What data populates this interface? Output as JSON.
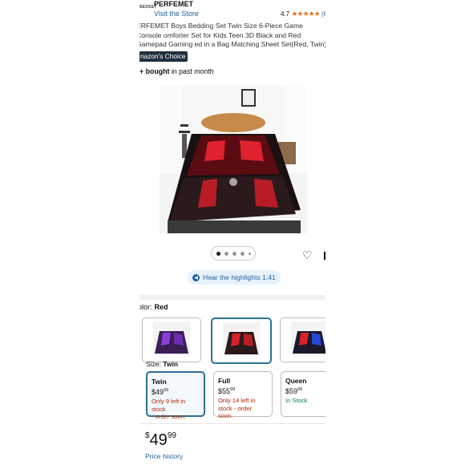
{
  "brand": {
    "logo_text": "BEDSET",
    "name": "PERFEMET",
    "visit_label": "Visit the Store",
    "rating": "4.7",
    "rating_count": "(6"
  },
  "product": {
    "title": "ERFEMET Boys Bedding Set Twin Size 6-Piece Game Console omforter Set for Kids Teen 3D Black and Red Gamepad Gaming ed in a Bag Matching Sheet Set(Red, Twin)",
    "badge": "nazon's Choice",
    "bought_count": "+ bought",
    "bought_suffix": " in past month"
  },
  "actions": {
    "highlights_label": "Hear the highlights 1:41"
  },
  "variations": {
    "color_label": "olor:",
    "color_value": "Red",
    "size_label": "Size:",
    "size_value": "Twin",
    "sizes": [
      {
        "name": "Twin",
        "price_whole": "$49",
        "price_cents": "99",
        "stock_line1": "Only 9 left in stock",
        "stock_line2": "- order soon."
      },
      {
        "name": "Full",
        "price_whole": "$55",
        "price_cents": "99",
        "stock_line1": "Only 14 left in",
        "stock_line2": "stock - order soon."
      },
      {
        "name": "Queen",
        "price_whole": "$59",
        "price_cents": "99",
        "stock_line1": "In Stock",
        "stock_line2": ""
      }
    ]
  },
  "buybox": {
    "currency": "$",
    "price_whole": "49",
    "price_cents": "99",
    "price_history": "Price history"
  },
  "colors": {
    "link": "#2162a1",
    "star": "#de7921",
    "low_stock": "#b12704",
    "in_stock": "#067d62",
    "selected_border": "#2a6f97"
  },
  "icons": [
    "heart-icon",
    "share-icon",
    "audio-icon",
    "star-icon"
  ],
  "carousel": {
    "count": 5,
    "active": 1
  }
}
